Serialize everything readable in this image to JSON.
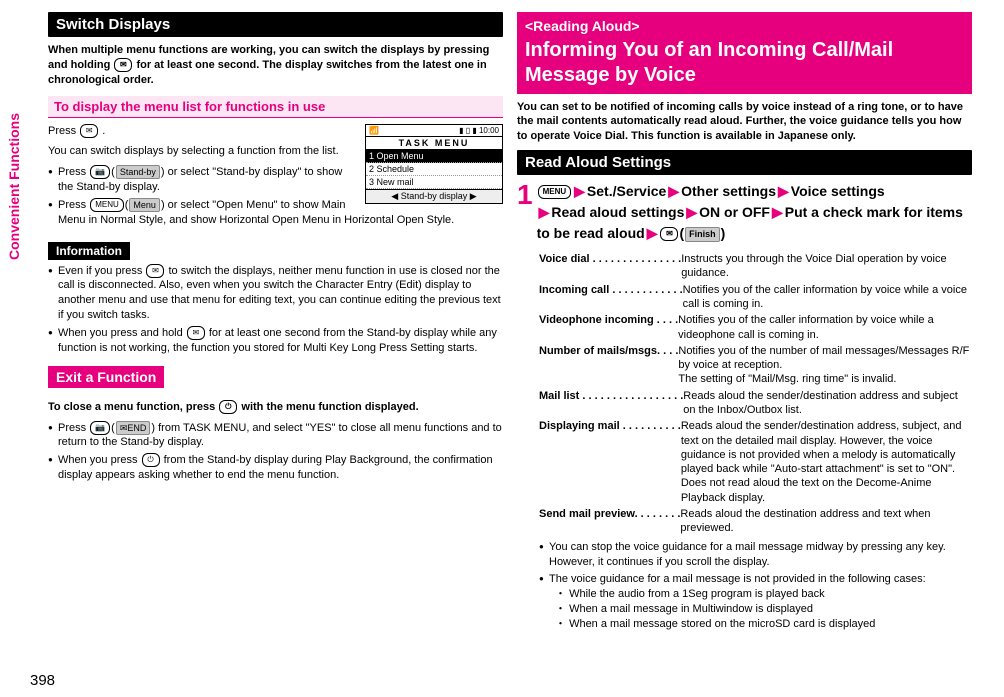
{
  "sideTab": "Convenient Functions",
  "pageNum": "398",
  "left": {
    "heading1": "Switch Displays",
    "intro": "When multiple menu functions are working, you can switch the displays by pressing and holding ",
    "introKey": "✉",
    "intro2": " for at least one second. The display switches from the latest one in chronological order.",
    "sub1": "To display the menu list for functions in use",
    "p1a": "Press ",
    "p1aKey": "✉",
    "p1b": ".",
    "p2": "You can switch displays by selecting a function from the list.",
    "b1a": "Press ",
    "b1aKey": "📷",
    "b1soft": "Stand-by",
    "b1b": " or select \"Stand-by display\" to show the Stand-by display.",
    "b2a": "Press ",
    "b2aKey": "MENU",
    "b2soft": "Menu",
    "b2b": " or select \"Open Menu\" to show Main Menu in Normal Style, and show Horizontal Open Menu in Horizontal Open Style.",
    "infoLabel": "Information",
    "info1a": "Even if you press ",
    "info1key": "✉",
    "info1b": " to switch the displays, neither menu function in use is closed nor the call is disconnected. Also, even when you switch the Character Entry (Edit) display to another menu and use that menu for editing text, you can continue editing the previous text if you switch tasks.",
    "info2a": "When you press and hold ",
    "info2key": "✉",
    "info2b": " for at least one second from the Stand-by display while any function is not working, the function you stored for Multi Key Long Press Setting starts.",
    "heading2": "Exit a Function",
    "exit1a": "To close a menu function, press ",
    "exit1key": "⏻",
    "exit1b": " with the menu function displayed.",
    "exitB1a": "Press ",
    "exitB1key": "📷",
    "exitB1soft": "✉END",
    "exitB1b": " from TASK MENU, and select \"YES\" to close all menu functions and to return to the Stand-by display.",
    "exitB2a": "When you press ",
    "exitB2key": "⏻",
    "exitB2b": " from the Stand-by display during Play Background, the confirmation display appears asking whether to end the menu function.",
    "scr": {
      "time": "▮ ▯ ▮ 10:00",
      "title": "TASK MENU",
      "item1": "1 Open Menu",
      "item2": "2 Schedule",
      "item3": "3 New mail",
      "soft": "◀ Stand-by display ▶",
      "sig": "📶"
    }
  },
  "right": {
    "tag": "<Reading Aloud>",
    "title": "Informing You of an Incoming Call/Mail Message by Voice",
    "intro": "You can set to be notified of incoming calls by voice instead of a ring tone, or to have the mail contents automatically read aloud. Further, the voice guidance tells you how to operate Voice Dial. This function is available in Japanese only.",
    "sub": "Read Aloud Settings",
    "stepNum": "1",
    "stepKey": "MENU",
    "nav1": "Set./Service",
    "nav2": "Other settings",
    "nav3": "Voice settings",
    "nav4": "Read aloud settings",
    "nav5": "ON or OFF",
    "nav6": "Put a check mark for items to be read aloud",
    "navEndKey": "✉",
    "navEndSoft": "Finish",
    "rows": [
      {
        "label": "Voice dial",
        "dots": " . . . . . . . . . . . . . . .",
        "desc": "Instructs you through the Voice Dial operation by voice guidance."
      },
      {
        "label": "Incoming call",
        "dots": " . . . . . . . . . . . .",
        "desc": "Notifies you of the caller information by voice while a voice call is coming in."
      },
      {
        "label": "Videophone incoming",
        "dots": " . . . .",
        "desc": "Notifies you of the caller information by voice while a videophone call is coming in."
      },
      {
        "label": "Number of mails/msgs.",
        "dots": " . . .",
        "desc": "Notifies you of the number of mail messages/Messages R/F by voice at reception.\nThe setting of \"Mail/Msg. ring time\" is invalid."
      },
      {
        "label": "Mail list",
        "dots": " . . . . . . . . . . . . . . . . .",
        "desc": "Reads aloud the sender/destination address and subject on the Inbox/Outbox list."
      },
      {
        "label": "Displaying mail",
        "dots": " . . . . . . . . . .",
        "desc": "Reads aloud the sender/destination address, subject, and text on the detailed mail display. However, the voice guidance is not provided when a melody is automatically played back while \"Auto-start attachment\" is set to \"ON\".\nDoes not read aloud the text on the Decome-Anime Playback display."
      },
      {
        "label": "Send mail preview",
        "dots": ". . . . . . . .",
        "desc": "Reads aloud the destination address and text when previewed."
      }
    ],
    "note1": "You can stop the voice guidance for a mail message midway by pressing any key. However, it continues if you scroll the display.",
    "note2": "The voice guidance for a mail message is not provided in the following cases:",
    "note2a": "While the audio from a 1Seg program is played back",
    "note2b": "When a mail message in Multiwindow is displayed",
    "note2c": "When a mail message stored on the microSD card is displayed"
  }
}
